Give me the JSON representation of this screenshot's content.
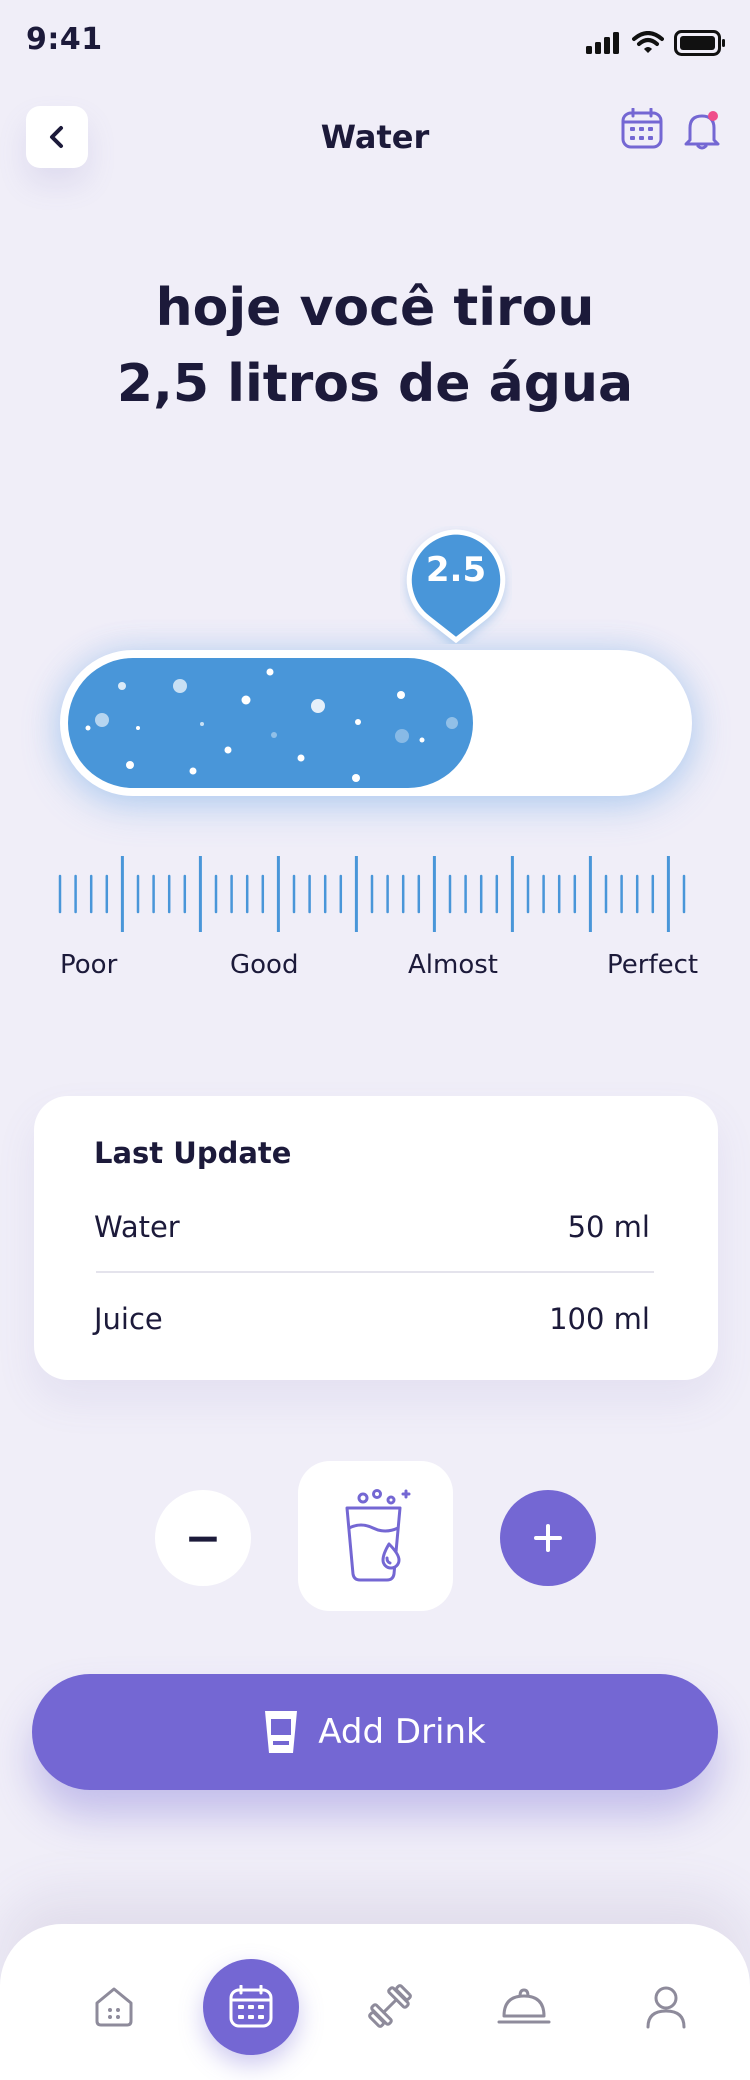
{
  "status_bar": {
    "time": "9:41"
  },
  "header": {
    "title": "Water"
  },
  "headline": {
    "line1": "hoje você tirou",
    "line2": "2,5 litros de água"
  },
  "intake": {
    "value_label": "2.5",
    "fill_fraction": 0.658,
    "scale_labels": [
      "Poor",
      "Good",
      "Almost",
      "Perfect"
    ],
    "fill_color": "#4996d9"
  },
  "last_update": {
    "title": "Last Update",
    "rows": [
      {
        "label": "Water",
        "value": "50 ml"
      },
      {
        "label": "Juice",
        "value": "100 ml"
      }
    ]
  },
  "stepper": {
    "minus": "−"
  },
  "add_button": {
    "label": "Add Drink"
  },
  "tabbar": {
    "items": [
      "home-icon",
      "calendar-icon",
      "dumbbell-icon",
      "food-cloche-icon",
      "profile-icon"
    ],
    "active": "calendar-icon"
  },
  "colors": {
    "accent": "#7467d3",
    "water": "#4996d9",
    "background": "#f0eef8"
  }
}
